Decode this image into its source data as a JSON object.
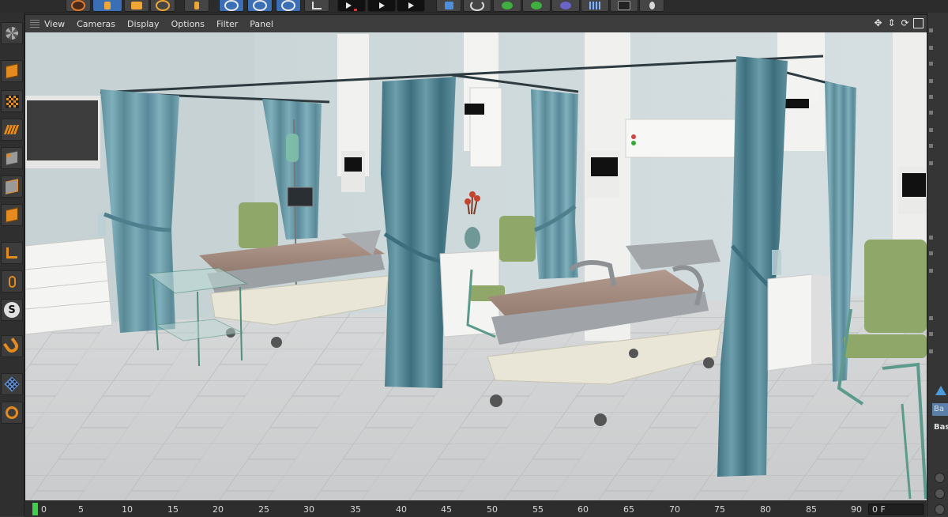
{
  "toolbar": {
    "tools": [
      {
        "icon": "undo-icon"
      },
      {
        "icon": "move-icon",
        "active": true
      },
      {
        "icon": "scale-icon"
      },
      {
        "icon": "rotate-icon"
      },
      {
        "icon": "live-selection-icon"
      },
      {
        "icon": "x-axis-lock-icon",
        "active": true
      },
      {
        "icon": "y-axis-lock-icon",
        "active": true
      },
      {
        "icon": "z-axis-lock-icon",
        "active": true
      },
      {
        "icon": "coordinate-system-icon"
      },
      {
        "icon": "render-region-icon"
      },
      {
        "icon": "render-to-viewer-icon"
      },
      {
        "icon": "render-settings-icon"
      },
      {
        "icon": "cube-primitive-icon"
      },
      {
        "icon": "spline-pen-icon"
      },
      {
        "icon": "subdivision-surface-icon"
      },
      {
        "icon": "cloner-icon"
      },
      {
        "icon": "deformer-icon"
      },
      {
        "icon": "floor-environment-icon"
      },
      {
        "icon": "camera-icon"
      },
      {
        "icon": "light-icon"
      }
    ]
  },
  "left_palette": {
    "tools": [
      "make-editable-icon",
      "model-mode-icon",
      "texture-mode-icon",
      "workplane-mode-icon",
      "points-mode-icon",
      "edges-mode-icon",
      "polygons-mode-icon",
      "axis-mode-icon",
      "tweak-mode-icon",
      "snap-icon",
      "magnet-icon",
      "workplane-lock-icon",
      "solo-mode-icon"
    ]
  },
  "viewport": {
    "menu": [
      "View",
      "Cameras",
      "Display",
      "Filter",
      "Panel"
    ],
    "menu_options": "Options",
    "nav_icons": [
      "pan-icon",
      "zoom-icon",
      "orbit-icon",
      "maximize-icon"
    ]
  },
  "timeline": {
    "ticks": [
      "0",
      "5",
      "10",
      "15",
      "20",
      "25",
      "30",
      "35",
      "40",
      "45",
      "50",
      "55",
      "60",
      "65",
      "70",
      "75",
      "80",
      "85",
      "90"
    ],
    "current_frame": "0 F"
  },
  "right_panel": {
    "tab_label": "Ba",
    "section_label": "Bas"
  },
  "colors": {
    "accent_orange": "#e38b1e",
    "active_blue": "#3b6fb5",
    "timeline_cursor": "#3fd04a",
    "curtain": "#6e9fac",
    "wall": "#cfd9dc",
    "floor": "#d3d5d6",
    "seat_green": "#8fa86a"
  }
}
